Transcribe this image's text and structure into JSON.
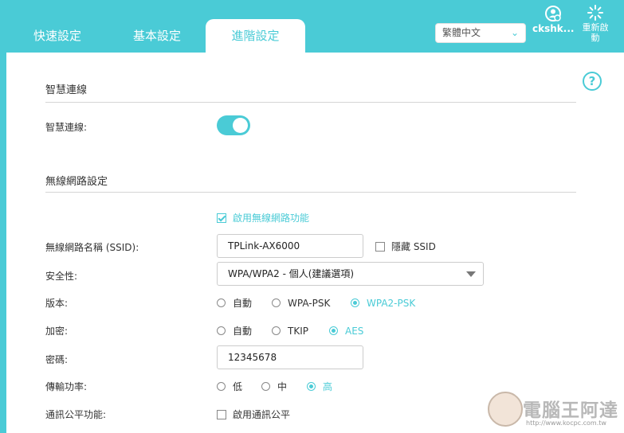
{
  "tabs": [
    {
      "label": "快速設定"
    },
    {
      "label": "基本設定"
    },
    {
      "label": "進階設定"
    }
  ],
  "header": {
    "language": "繁體中文",
    "user_label": "ckshk...",
    "reboot_label_line1": "重新啟",
    "reboot_label_line2": "動"
  },
  "help_label": "?",
  "smart_connect": {
    "section_title": "智慧連線",
    "label": "智慧連線:",
    "enabled": true
  },
  "wireless": {
    "section_title": "無線網路設定",
    "enable_label": "啟用無線網路功能",
    "enable_checked": true,
    "ssid_label": "無線網路名稱 (SSID):",
    "ssid_value": "TPLink-AX6000",
    "hide_ssid_label": "隱藏 SSID",
    "security_label": "安全性:",
    "security_value": "WPA/WPA2 - 個人(建議選項)",
    "version_label": "版本:",
    "version_options": [
      "自動",
      "WPA-PSK",
      "WPA2-PSK"
    ],
    "version_selected": "WPA2-PSK",
    "encryption_label": "加密:",
    "encryption_options": [
      "自動",
      "TKIP",
      "AES"
    ],
    "encryption_selected": "AES",
    "password_label": "密碼:",
    "password_value": "12345678",
    "power_label": "傳輸功率:",
    "power_options": [
      "低",
      "中",
      "高"
    ],
    "power_selected": "高",
    "fairness_label": "通訊公平功能:",
    "fairness_checkbox_label": "啟用通訊公平"
  },
  "watermark": {
    "text": "電腦王阿達",
    "url": "http://www.kocpc.com.tw"
  },
  "colors": {
    "accent": "#4acbd6",
    "panel": "#ffffff"
  }
}
